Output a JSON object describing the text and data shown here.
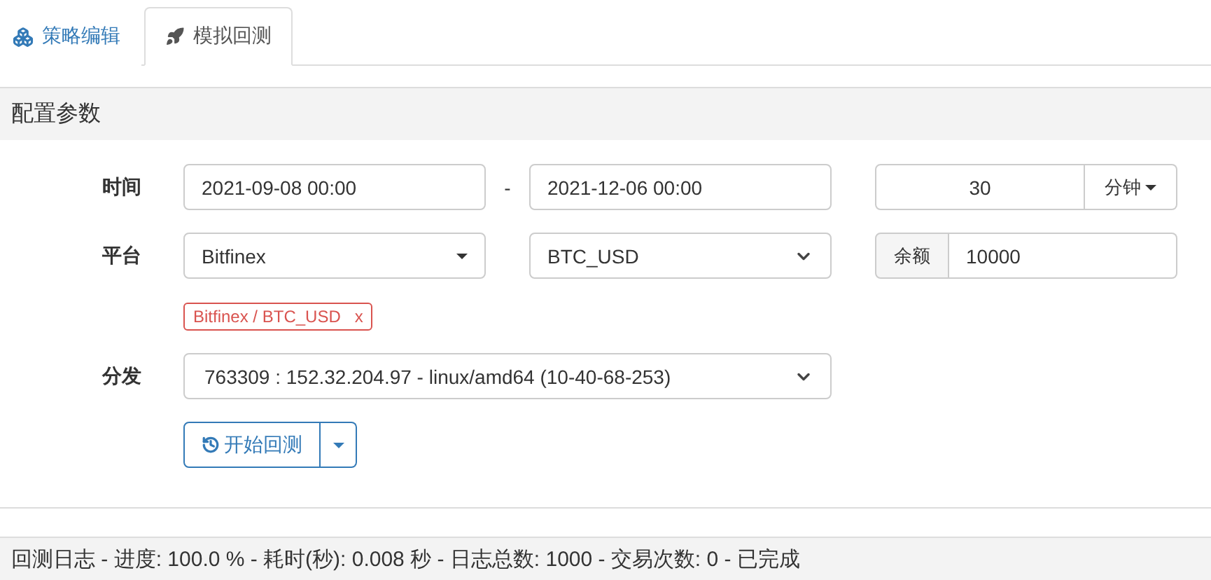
{
  "tabs": [
    {
      "label": "策略编辑",
      "selected": false
    },
    {
      "label": "模拟回测",
      "selected": true
    }
  ],
  "panel": {
    "title": "配置参数"
  },
  "time": {
    "label": "时间",
    "start": "2021-09-08 00:00",
    "separator": "-",
    "end": "2021-12-06 00:00",
    "period": "30",
    "period_unit": "分钟"
  },
  "platform": {
    "label": "平台",
    "exchange": "Bitfinex",
    "pair": "BTC_USD",
    "balance_label": "余额",
    "balance": "10000"
  },
  "tags": [
    {
      "text": "Bitfinex / BTC_USD",
      "remove": "x"
    }
  ],
  "distribute": {
    "label": "分发",
    "node": "763309 : 152.32.204.97 - linux/amd64 (10-40-68-253)"
  },
  "start_button": {
    "label": "开始回测"
  },
  "log": {
    "text": "回测日志 - 进度: 100.0 % - 耗时(秒): 0.008 秒 - 日志总数: 1000 - 交易次数: 0 - 已完成"
  }
}
